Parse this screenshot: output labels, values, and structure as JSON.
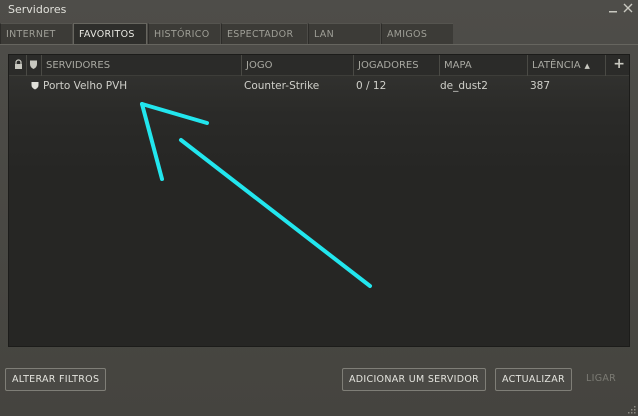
{
  "window": {
    "title": "Servidores"
  },
  "tabs": [
    {
      "label": "INTERNET"
    },
    {
      "label": "FAVORITOS"
    },
    {
      "label": "HISTÓRICO"
    },
    {
      "label": "ESPECTADOR"
    },
    {
      "label": "LAN"
    },
    {
      "label": "AMIGOS"
    }
  ],
  "active_tab": "FAVORITOS",
  "columns": {
    "servidores": "SERVIDORES",
    "jogo": "JOGO",
    "jogadores": "JOGADORES",
    "mapa": "MAPA",
    "latencia": "LATÊNCIA",
    "sort": "ascending"
  },
  "rows": [
    {
      "servidor": "Porto Velho PVH",
      "jogo": "Counter-Strike",
      "jogadores": "0 / 12",
      "mapa": "de_dust2",
      "latencia": "387"
    }
  ],
  "buttons": {
    "alterar_filtros": "ALTERAR FILTROS",
    "adicionar_servidor": "ADICIONAR UM SERVIDOR",
    "actualizar": "ACTUALIZAR",
    "ligar": "LIGAR"
  },
  "icons": {
    "minimize": "minimize-icon",
    "close": "close-icon",
    "lock": "lock-icon",
    "shield": "shield-icon",
    "add": "plus-icon",
    "resize": "resize-grip-icon"
  },
  "colors": {
    "annotation_arrow": "#22e6ee",
    "window_bg": "#4c4b47",
    "list_bg": "#262624"
  }
}
